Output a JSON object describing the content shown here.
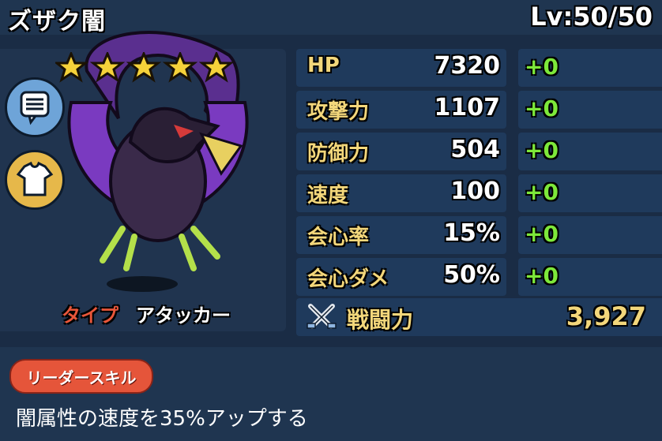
{
  "header": {
    "name": "ズザク闇",
    "level": "Lv:50/50"
  },
  "character": {
    "rarity_stars": 5,
    "type_label": "タイプ",
    "type_value": "アタッカー",
    "icons": [
      "comment-icon",
      "shirt-icon",
      "star-icon"
    ]
  },
  "stats": [
    {
      "label": "HP",
      "value": "7320",
      "bonus": "+0"
    },
    {
      "label": "攻撃力",
      "value": "1107",
      "bonus": "+0"
    },
    {
      "label": "防御力",
      "value": "504",
      "bonus": "+0"
    },
    {
      "label": "速度",
      "value": "100",
      "bonus": "+0"
    },
    {
      "label": "会心率",
      "value": "15%",
      "bonus": "+0"
    },
    {
      "label": "会心ダメ",
      "value": "50%",
      "bonus": "+0"
    }
  ],
  "power": {
    "label": "戦闘力",
    "value": "3,927",
    "icon": "crossed-swords-icon"
  },
  "leader_skill": {
    "badge": "リーダースキル",
    "description": "闇属性の速度を35%アップする"
  },
  "colors": {
    "background": "#1a2c45",
    "panel": "#1f3a5c",
    "gold_text": "#f3d77b",
    "bonus_green": "#7de83a",
    "type_red": "#e8563a"
  }
}
